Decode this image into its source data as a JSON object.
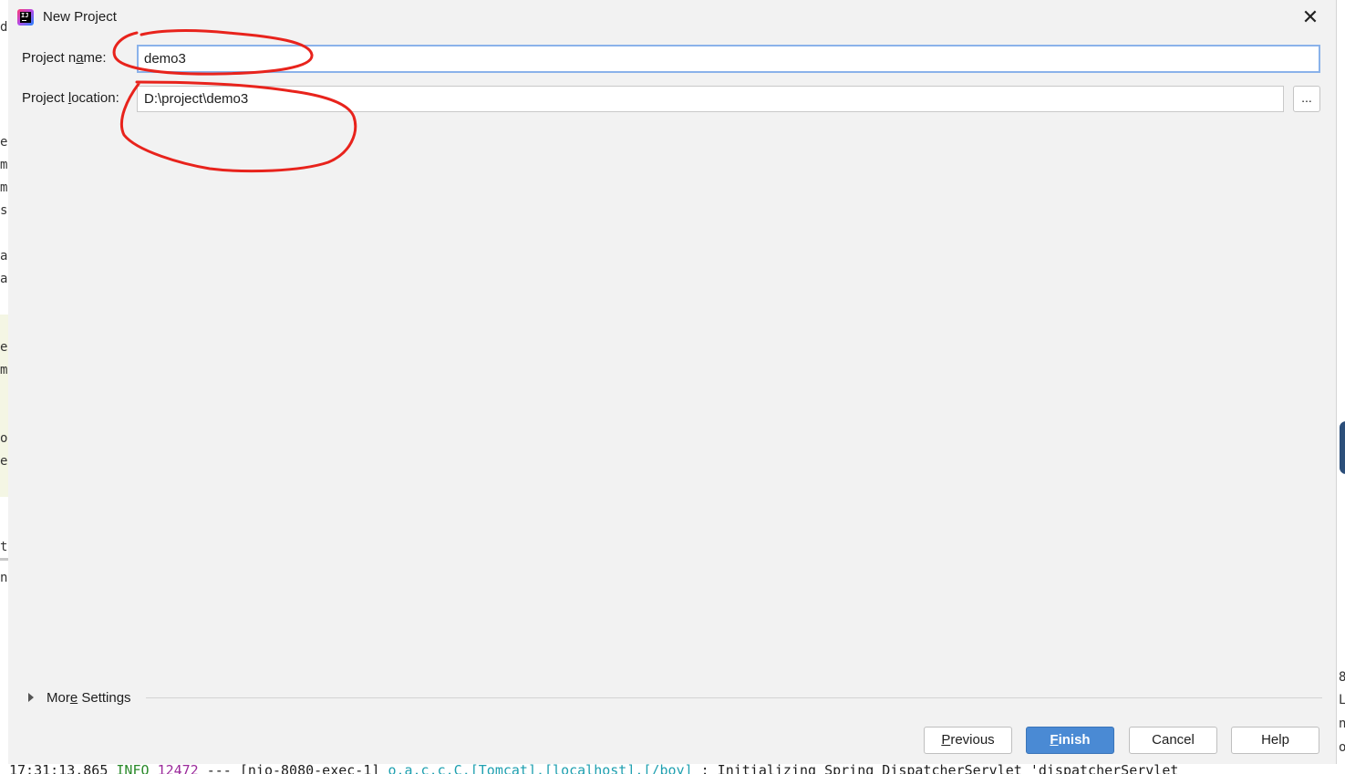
{
  "dialog": {
    "title": "New Project",
    "close_glyph": "✕",
    "app_icon_text": "IJ"
  },
  "form": {
    "name_label_before": "Project n",
    "name_label_mnemonic": "a",
    "name_label_after": "me:",
    "name_value": "demo3",
    "location_label_before": "Project ",
    "location_label_mnemonic": "l",
    "location_label_after": "ocation:",
    "location_value": "D:\\project\\demo3",
    "browse_label": "..."
  },
  "more_settings": {
    "label_before": "Mor",
    "label_mnemonic": "e",
    "label_after": " Settings"
  },
  "buttons": {
    "previous_mnemonic": "P",
    "previous_rest": "revious",
    "finish_mnemonic": "F",
    "finish_rest": "inish",
    "cancel": "Cancel",
    "help": "Help"
  },
  "background": {
    "left_chars": [
      "d",
      "ex",
      "m",
      "m",
      "s",
      "a",
      "a",
      "ex",
      "m",
      "o",
      "e",
      "ti",
      "nc"
    ],
    "right_chars": [
      "8",
      "Le",
      "n",
      "or"
    ],
    "console": {
      "time": "17:31:13.865",
      "level": "INFO",
      "pid": "12472",
      "sep": "---",
      "thread": "[nio-8080-exec-1]",
      "logger": "o.a.c.c.C.[Tomcat].[localhost].[/boy]",
      "message": ": Initializing Spring DispatcherServlet 'dispatcherServlet"
    }
  },
  "colors": {
    "primary_button": "#4a8ad4",
    "focus_border": "#8ab2ea",
    "annotation": "#e8231c",
    "log_info": "#2a8a2a",
    "log_pid": "#9b2a9b",
    "log_logger": "#1fa0b0"
  }
}
